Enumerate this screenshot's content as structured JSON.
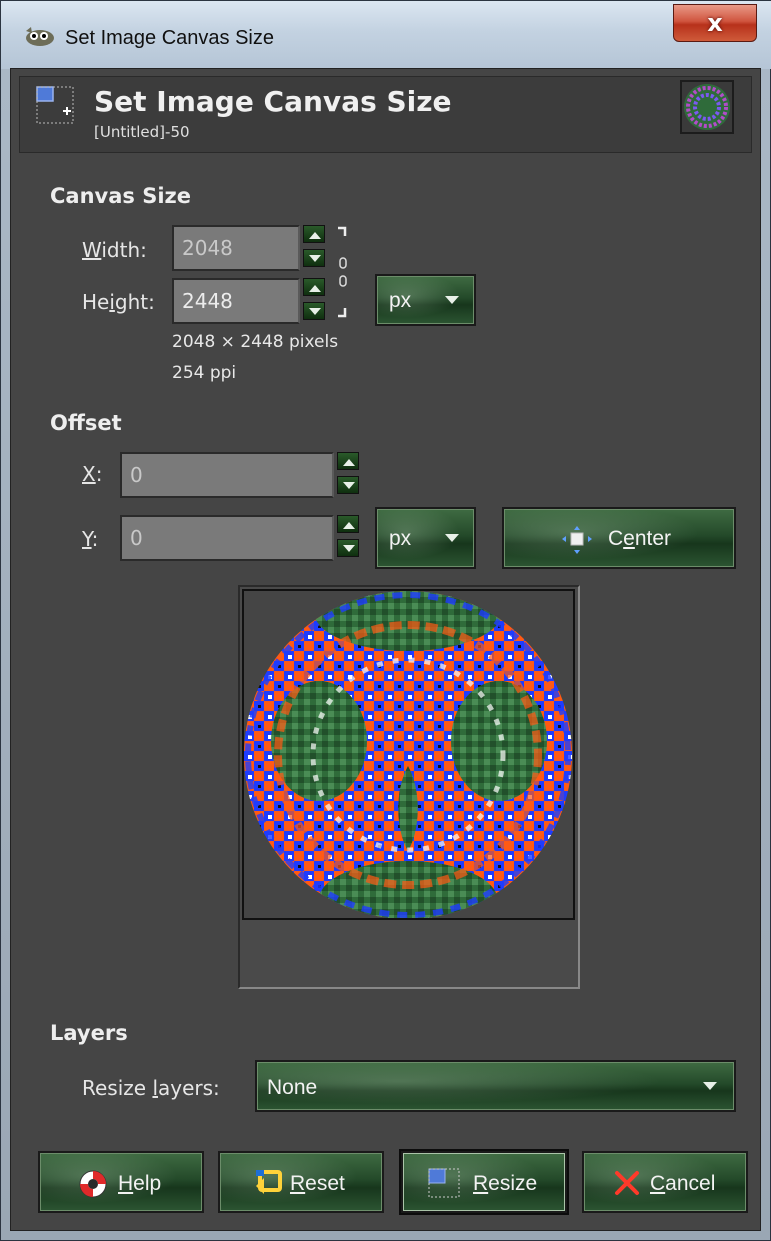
{
  "window": {
    "title": "Set Image Canvas Size",
    "close_glyph": "x"
  },
  "header": {
    "title": "Set Image Canvas Size",
    "subtitle": "[Untitled]-50"
  },
  "canvas_size": {
    "section_label": "Canvas Size",
    "width_label_u": "W",
    "width_label_rest": "idth:",
    "width_value": "2048",
    "height_label_pre": "He",
    "height_label_u": "i",
    "height_label_rest": "ght:",
    "height_value": "2448",
    "unit": "px",
    "pixels_text": "2048 × 2448 pixels",
    "ppi_text": "254 ppi"
  },
  "offset": {
    "section_label": "Offset",
    "x_label_u": "X",
    "x_label_rest": ":",
    "x_value": "0",
    "y_label_u": "Y",
    "y_label_rest": ":",
    "y_value": "0",
    "unit": "px",
    "center_pre": "C",
    "center_u": "e",
    "center_rest": "nter"
  },
  "layers": {
    "section_label": "Layers",
    "resize_label_pre": "Resize ",
    "resize_label_u": "l",
    "resize_label_rest": "ayers:",
    "resize_value": "None"
  },
  "buttons": {
    "help_u": "H",
    "help_rest": "elp",
    "reset_u": "R",
    "reset_rest": "eset",
    "resize_u": "R",
    "resize_rest": "esize",
    "cancel_u": "C",
    "cancel_rest": "ancel"
  },
  "colors": {
    "dialog_bg": "#454545",
    "button_green": "#244a2a",
    "preview_orange": "#ff5a14",
    "preview_blue": "#1e3cff",
    "preview_green": "#2f6b3a"
  },
  "icons": {
    "title": "gimp-wilber-icon",
    "header": "canvas-size-icon",
    "help": "lifebuoy-icon",
    "reset": "reset-icon",
    "resize": "canvas-resize-icon",
    "cancel": "cancel-x-icon",
    "center": "center-icon",
    "chain": "chain-link-icon"
  }
}
